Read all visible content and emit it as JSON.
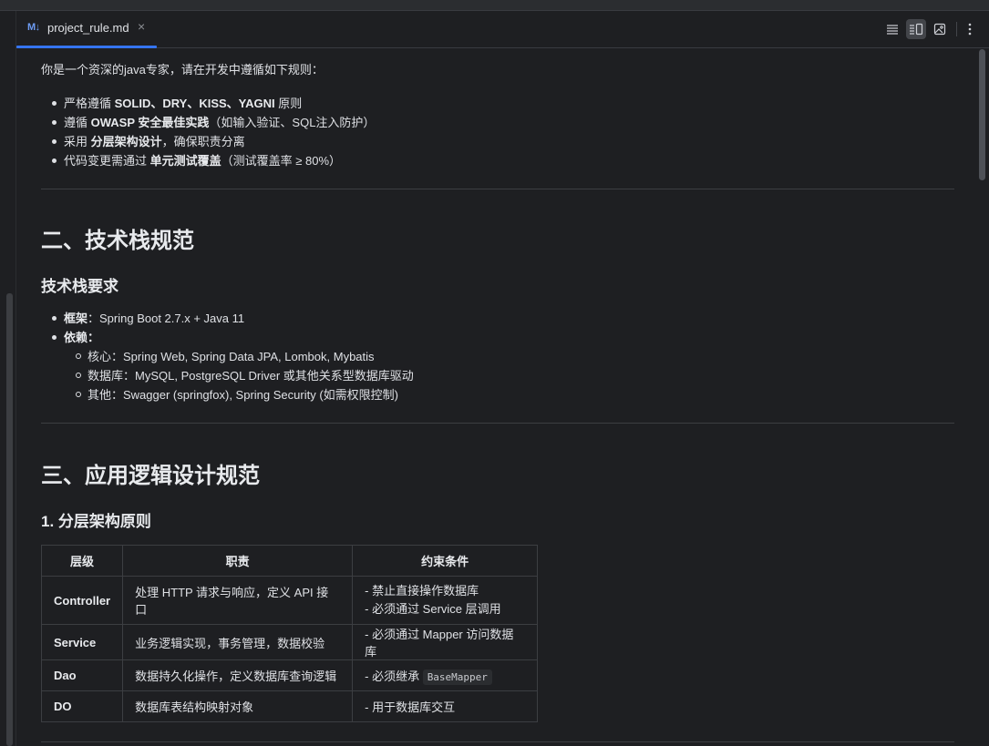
{
  "tab": {
    "icon": "M↓",
    "title": "project_rule.md"
  },
  "toolbar": [
    "list-icon",
    "split-view-icon",
    "preview-icon",
    "more-icon"
  ],
  "intro": "你是一个资深的java专家，请在开发中遵循如下规则：",
  "rules": [
    {
      "pre": "严格遵循 ",
      "bold": "SOLID、DRY、KISS、YAGNI",
      "post": " 原则"
    },
    {
      "pre": "遵循 ",
      "bold": "OWASP 安全最佳实践",
      "post": "（如输入验证、SQL注入防护）"
    },
    {
      "pre": "采用 ",
      "bold": "分层架构设计",
      "post": "，确保职责分离"
    },
    {
      "pre": "代码变更需通过 ",
      "bold": "单元测试覆盖",
      "post": "（测试覆盖率 ≥ 80%）"
    }
  ],
  "section2": {
    "title": "二、技术栈规范",
    "subtitle": "技术栈要求",
    "framework_label": "框架",
    "framework_value": "：Spring Boot 2.7.x + Java 11",
    "deps_label": "依赖",
    "deps_colon": "：",
    "deps": [
      "核心：Spring Web, Spring Data JPA, Lombok, Mybatis",
      "数据库：MySQL, PostgreSQL Driver 或其他关系型数据库驱动",
      "其他：Swagger (springfox), Spring Security (如需权限控制)"
    ]
  },
  "section3": {
    "title": "三、应用逻辑设计规范",
    "subtitle": "1. 分层架构原则",
    "headers": [
      "层级",
      "职责",
      "约束条件"
    ],
    "rows": [
      {
        "layer": "Controller",
        "duty": "处理 HTTP 请求与响应，定义 API 接口",
        "c1": "- 禁止直接操作数据库",
        "c2": "- 必须通过 Service 层调用",
        "code": ""
      },
      {
        "layer": "Service",
        "duty": "业务逻辑实现，事务管理，数据校验",
        "c1": "- 必须通过 Mapper 访问数据库",
        "c2": "",
        "code": ""
      },
      {
        "layer": "Dao",
        "duty": "数据持久化操作，定义数据库查询逻辑",
        "c1": "- 必须继承 ",
        "c2": "",
        "code": "BaseMapper"
      },
      {
        "layer": "DO",
        "duty": "数据库表结构映射对象",
        "c1": "- 用于数据库交互",
        "c2": "",
        "code": ""
      }
    ]
  }
}
